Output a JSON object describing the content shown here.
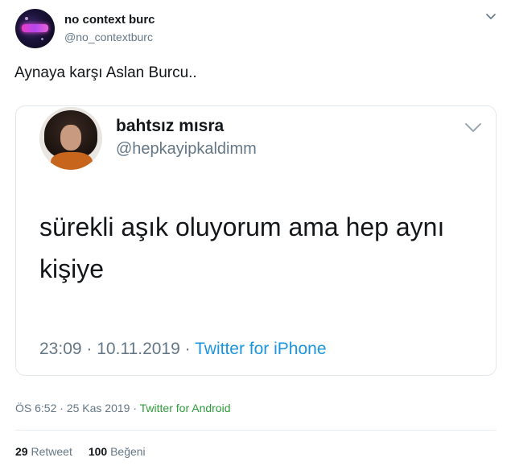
{
  "tweet": {
    "display_name": "no context burc",
    "handle": "@no_contextburc",
    "text": "Aynaya karşı Aslan Burcu..",
    "time": "ÖS 6:52",
    "date": "25 Kas 2019",
    "separator": "·",
    "source": "Twitter for Android",
    "retweets": {
      "count": "29",
      "label": "Retweet"
    },
    "likes": {
      "count": "100",
      "label": "Beğeni"
    }
  },
  "quoted": {
    "display_name": "bahtsız mısra",
    "handle": "@hepkayipkaldimm",
    "text": "sürekli aşık oluyorum ama hep aynı kişiye",
    "time": "23:09",
    "date": "10.11.2019",
    "separator": "·",
    "source": "Twitter for iPhone"
  },
  "icons": {
    "main_menu": "chevron-down-icon",
    "quoted_menu": "chevron-down-icon"
  },
  "colors": {
    "text": "#14171a",
    "secondary": "#657786",
    "link": "#1b95e0",
    "android_source": "#2e9c3b",
    "border": "#e1e8ed"
  }
}
